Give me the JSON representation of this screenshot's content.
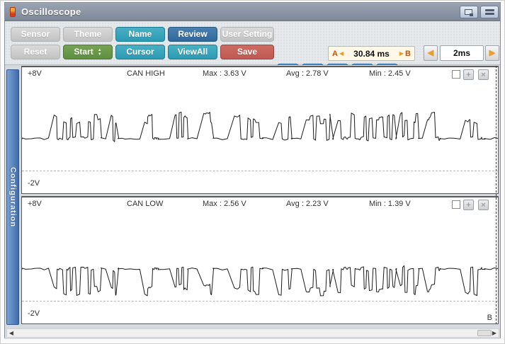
{
  "window": {
    "title": "Oscilloscope",
    "controls": [
      {
        "name": "restore-window"
      },
      {
        "name": "toggle-layout"
      }
    ]
  },
  "toolbar": {
    "row1": [
      {
        "label": "Sensor",
        "style": "gray"
      },
      {
        "label": "Theme",
        "style": "gray"
      },
      {
        "label": "Name",
        "style": "teal"
      },
      {
        "label": "Review",
        "style": "blue"
      },
      {
        "label": "User Setting",
        "style": "gray"
      }
    ],
    "row2": [
      {
        "label": "Reset",
        "style": "gray"
      },
      {
        "label": "Start",
        "style": "green",
        "has_spinner": true
      },
      {
        "label": "Cursor",
        "style": "teal"
      },
      {
        "label": "ViewAll",
        "style": "teal"
      },
      {
        "label": "Save",
        "style": "red"
      }
    ],
    "ab_readout": {
      "a": "A",
      "time": "30.84 ms",
      "b": "B"
    },
    "timebase": {
      "value": "2ms"
    }
  },
  "transport": [
    {
      "name": "skip-start"
    },
    {
      "name": "step-back"
    },
    {
      "name": "stop"
    },
    {
      "name": "play"
    },
    {
      "name": "skip-end"
    }
  ],
  "sidebar": {
    "tab_label": "Configuration"
  },
  "channels": [
    {
      "scale_top": "+8V",
      "name": "CAN HIGH",
      "max": "Max : 3.63 V",
      "avg": "Avg : 2.78 V",
      "min": "Min : 2.45 V",
      "scale_bottom": "-2V",
      "polarity": "high"
    },
    {
      "scale_top": "+8V",
      "name": "CAN LOW",
      "max": "Max : 2.56 V",
      "avg": "Avg : 2.23 V",
      "min": "Min : 1.39 V",
      "scale_bottom": "-2V",
      "polarity": "low"
    }
  ],
  "cursor_b_label": "B",
  "colors": {
    "teal": "#2d9ab3",
    "blue": "#31689b",
    "green": "#5e9042",
    "red": "#c05a52",
    "transport_blue": "#1e6dc2",
    "accent_orange": "#f09c28",
    "ab_text": "#c8500a",
    "titlebar": "#8d96a6",
    "sidebar_blue": "#4878b4"
  },
  "chart_data": {
    "type": "line",
    "title": "CAN bus differential pair (oscilloscope capture)",
    "y_unit": "V",
    "ylim": [
      -2,
      8
    ],
    "x_window": "A to B = 30.84 ms, timebase 2ms",
    "grid": "one dashed horizontal reference line per channel near -1V",
    "bursts_x_fraction": [
      [
        0.057,
        0.164
      ],
      [
        0.177,
        0.197
      ],
      [
        0.254,
        0.281
      ],
      [
        0.317,
        0.346
      ],
      [
        0.369,
        0.397
      ],
      [
        0.435,
        0.503
      ],
      [
        0.528,
        0.562
      ],
      [
        0.592,
        0.645
      ],
      [
        0.657,
        0.78
      ],
      [
        0.785,
        0.829
      ],
      [
        0.847,
        0.874
      ],
      [
        0.921,
        0.963
      ]
    ],
    "series": [
      {
        "name": "CAN HIGH",
        "recessive_v": 2.5,
        "dominant_v": 3.6,
        "max_v": 3.63,
        "avg_v": 2.78,
        "min_v": 2.45
      },
      {
        "name": "CAN LOW",
        "recessive_v": 2.5,
        "dominant_v": 1.4,
        "max_v": 2.56,
        "avg_v": 2.23,
        "min_v": 1.39
      }
    ]
  }
}
